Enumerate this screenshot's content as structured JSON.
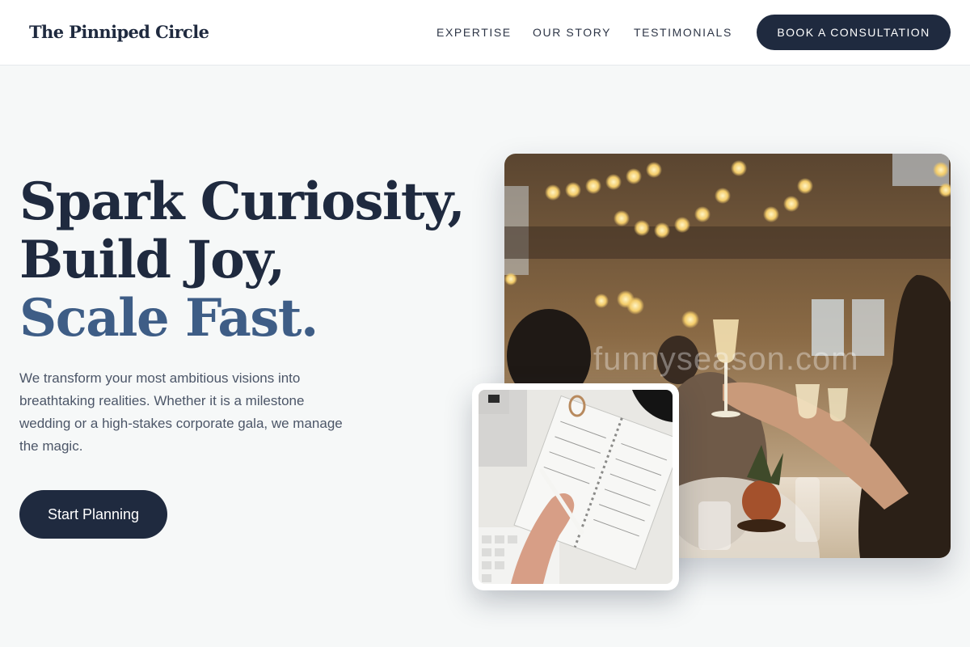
{
  "header": {
    "brand": "The Pinniped Circle",
    "nav": [
      "EXPERTISE",
      "OUR STORY",
      "TESTIMONIALS"
    ],
    "cta": "BOOK A CONSULTATION"
  },
  "hero": {
    "title_line1": "Spark Curiosity,",
    "title_line2": "Build Joy,",
    "title_line3": "Scale Fast.",
    "description": "We transform your most ambitious visions into breathtaking realities. Whether it is a milestone wedding or a high-stakes corporate gala, we manage the magic.",
    "cta": "Start Planning"
  },
  "images": {
    "main_watermark": "funnyseason.com",
    "main_subject": "celebration toast with champagne glasses under string lights",
    "small_subject": "hand writing in a spiral planner notebook on a desk"
  },
  "colors": {
    "navy": "#1f2a3f",
    "accent_blue": "#3e5d86",
    "background": "#f6f8f8"
  }
}
